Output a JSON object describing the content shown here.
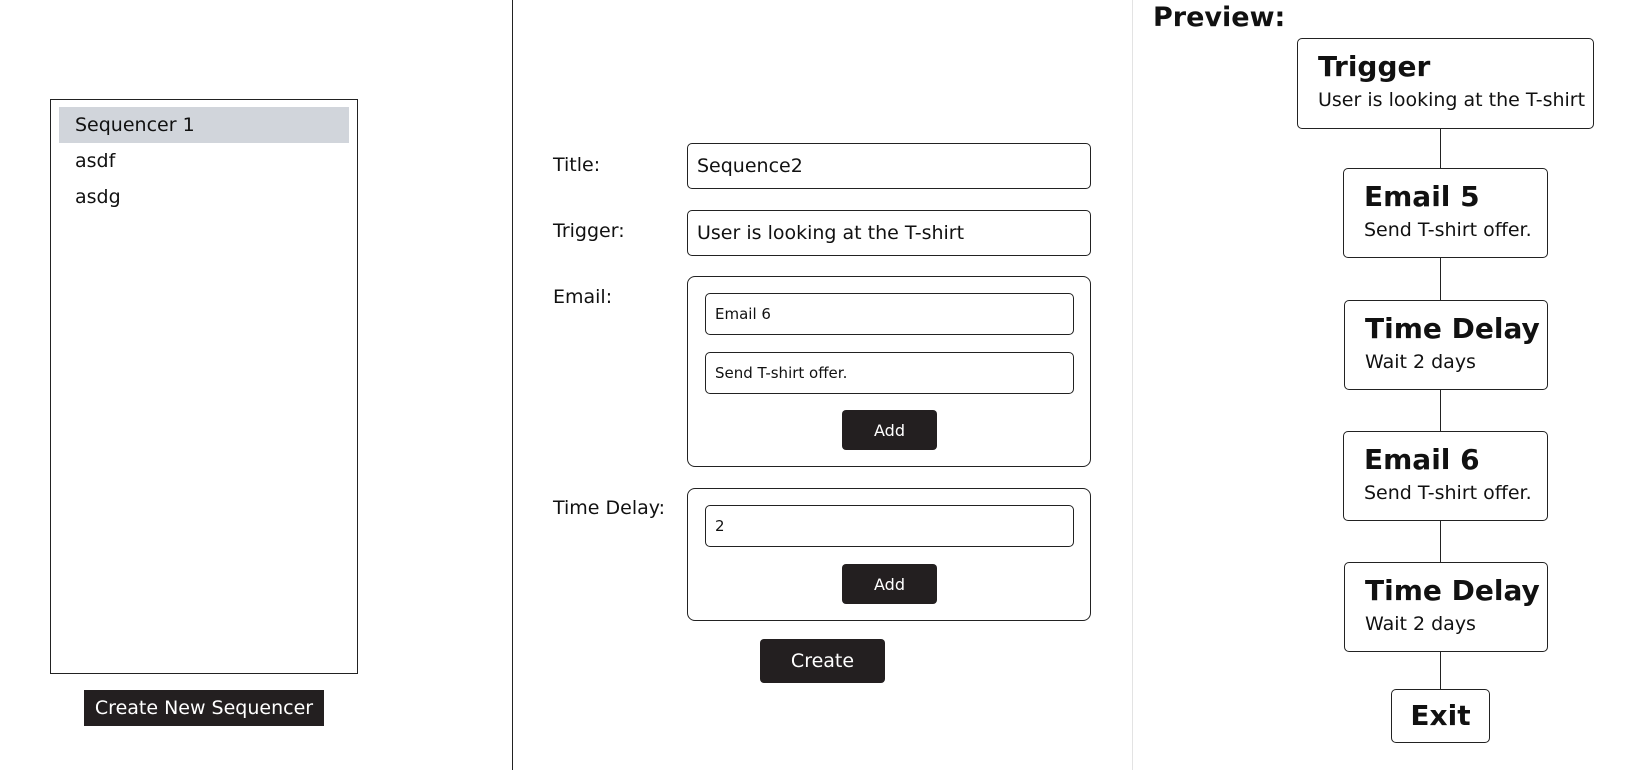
{
  "sidebar": {
    "items": [
      {
        "label": "Sequencer 1",
        "selected": true
      },
      {
        "label": "asdf",
        "selected": false
      },
      {
        "label": "asdg",
        "selected": false
      }
    ],
    "create_button": "Create New Sequencer"
  },
  "form": {
    "title_label": "Title:",
    "title_value": "Sequence2",
    "trigger_label": "Trigger:",
    "trigger_value": "User is looking at the T-shirt",
    "email_label": "Email:",
    "email_name_value": "Email 6",
    "email_body_value": "Send T-shirt offer.",
    "email_add_button": "Add",
    "delay_label": "Time Delay:",
    "delay_value": "2",
    "delay_add_button": "Add",
    "create_button": "Create"
  },
  "preview": {
    "heading": "Preview:",
    "nodes": [
      {
        "title": "Trigger",
        "subtitle": "User is looking at the T-shirt"
      },
      {
        "title": "Email 5",
        "subtitle": "Send T-shirt offer."
      },
      {
        "title": "Time Delay",
        "subtitle": "Wait 2 days"
      },
      {
        "title": "Email 6",
        "subtitle": "Send T-shirt offer."
      },
      {
        "title": "Time Delay",
        "subtitle": "Wait 2 days"
      }
    ],
    "exit_label": "Exit"
  },
  "colors": {
    "button_bg": "#231f20",
    "selected_bg": "#d1d5db"
  }
}
